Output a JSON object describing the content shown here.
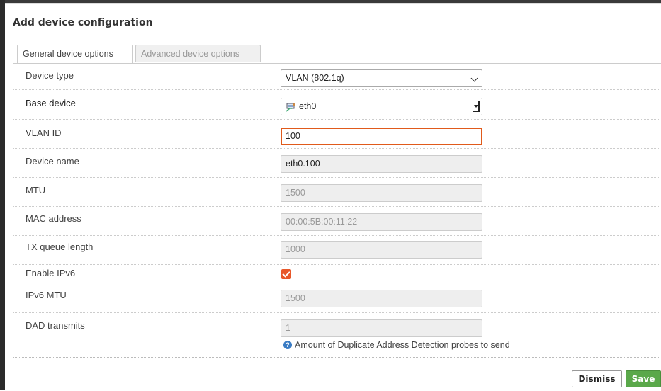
{
  "modal": {
    "title": "Add device configuration"
  },
  "tabs": [
    {
      "label": "General device options",
      "active": true
    },
    {
      "label": "Advanced device options",
      "active": false
    }
  ],
  "fields": {
    "device_type": {
      "label": "Device type",
      "value": "VLAN (802.1q)"
    },
    "base_device": {
      "label": "Base device",
      "value": "eth0",
      "icon": "network-port-icon"
    },
    "vlan_id": {
      "label": "VLAN ID",
      "value": "100"
    },
    "device_name": {
      "label": "Device name",
      "value": "eth0.100"
    },
    "mtu": {
      "label": "MTU",
      "placeholder": "1500"
    },
    "mac_address": {
      "label": "MAC address",
      "placeholder": "00:00:5B:00:11:22"
    },
    "tx_queue_length": {
      "label": "TX queue length",
      "placeholder": "1000"
    },
    "enable_ipv6": {
      "label": "Enable IPv6",
      "checked": true
    },
    "ipv6_mtu": {
      "label": "IPv6 MTU",
      "placeholder": "1500"
    },
    "dad_transmits": {
      "label": "DAD transmits",
      "placeholder": "1",
      "help": "Amount of Duplicate Address Detection probes to send"
    }
  },
  "buttons": {
    "dismiss": "Dismiss",
    "save": "Save"
  },
  "colors": {
    "accent": "#e8582a",
    "save_button": "#5aa84a",
    "help_icon": "#3a7cc4"
  }
}
